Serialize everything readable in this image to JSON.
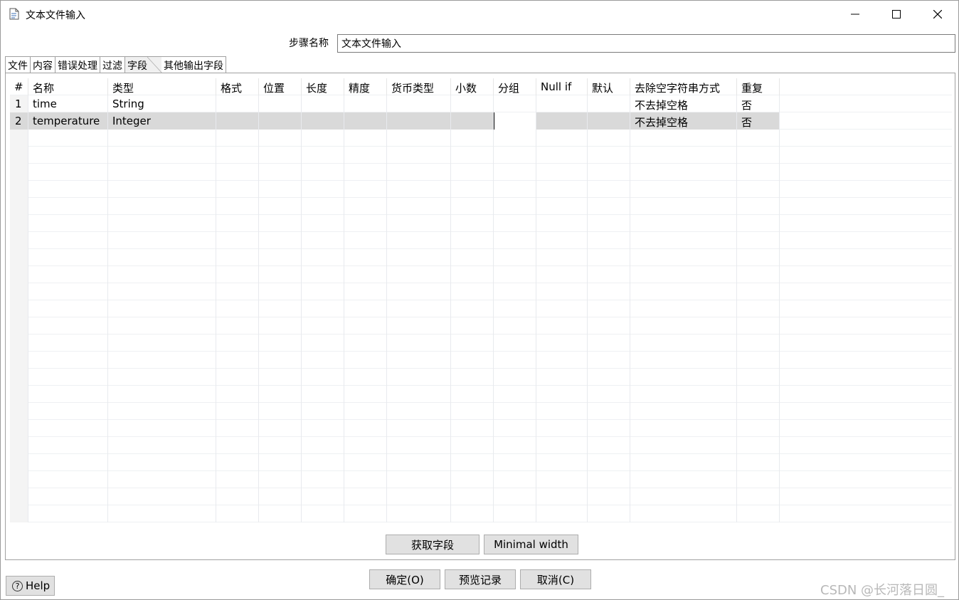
{
  "window": {
    "title": "文本文件输入",
    "minimize_icon": "minimize-icon",
    "maximize_icon": "maximize-icon",
    "close_icon": "close-icon"
  },
  "step": {
    "label": "步骤名称",
    "value": "文本文件输入"
  },
  "tabs": [
    {
      "label": "文件"
    },
    {
      "label": "内容"
    },
    {
      "label": "错误处理"
    },
    {
      "label": "过滤"
    },
    {
      "label": "字段",
      "active": true
    },
    {
      "label": "其他输出字段"
    }
  ],
  "table": {
    "columns": [
      "#",
      "名称",
      "类型",
      "格式",
      "位置",
      "长度",
      "精度",
      "货币类型",
      "小数",
      "分组",
      "Null if",
      "默认",
      "去除空字符串方式",
      "重复"
    ],
    "rows": [
      [
        "1",
        "time",
        "String",
        "",
        "",
        "",
        "",
        "",
        "",
        "",
        "",
        "",
        "不去掉空格",
        "否"
      ],
      [
        "2",
        "temperature",
        "Integer",
        "",
        "",
        "",
        "",
        "",
        "",
        "",
        "",
        "",
        "不去掉空格",
        "否"
      ]
    ],
    "selected_row": 1,
    "focused_column": 9
  },
  "panel_buttons": {
    "get_fields": "获取字段",
    "minimal_width": "Minimal width"
  },
  "footer": {
    "help": "Help",
    "ok": "确定(O)",
    "preview": "预览记录",
    "cancel": "取消(C)"
  },
  "watermark": "CSDN @长河落日圆_"
}
